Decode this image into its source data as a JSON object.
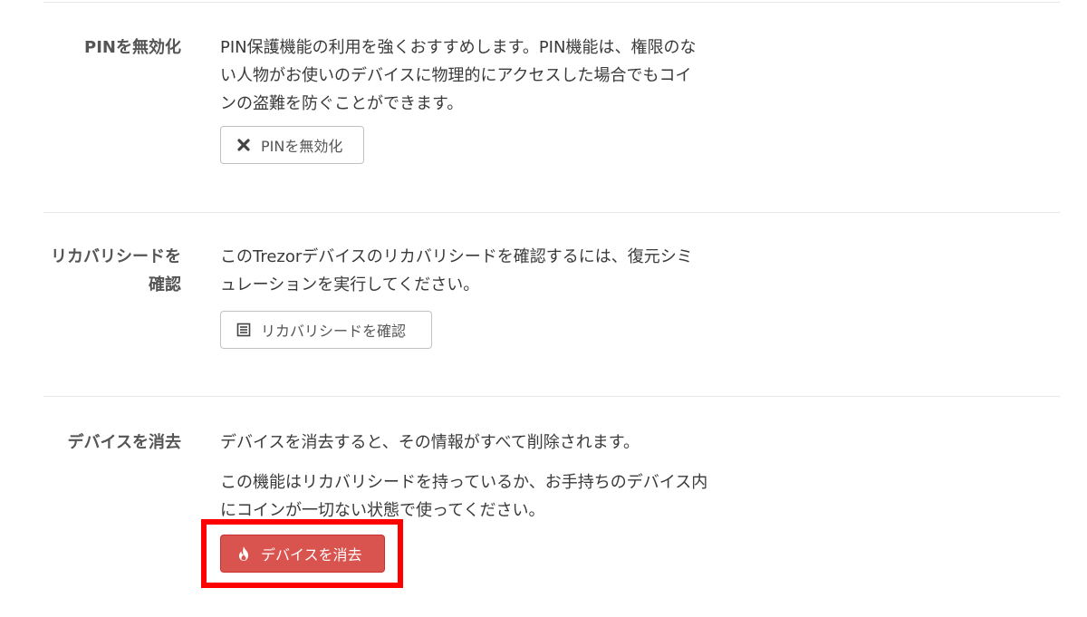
{
  "settings": {
    "disable_pin": {
      "label": "PINを無効化",
      "description": [
        "PIN保護機能の利用を強くおすすめします。PIN機能は、権限のない人物がお使いのデバイスに物理的にアクセスした場合でもコインの盗難を防ぐことができます。"
      ],
      "button_label": "PINを無効化",
      "button_icon": "close-icon"
    },
    "check_seed": {
      "label": "リカバリシードを確認",
      "description": [
        "このTrezorデバイスのリカバリシードを確認するには、復元シミュレーションを実行してください。"
      ],
      "button_label": "リカバリシードを確認",
      "button_icon": "list-icon"
    },
    "wipe_device": {
      "label": "デバイスを消去",
      "description": [
        "デバイスを消去すると、その情報がすべて削除されます。",
        "この機能はリカバリシードを持っているか、お手持ちのデバイス内にコインが一切ない状態で使ってください。"
      ],
      "button_label": "デバイスを消去",
      "button_icon": "fire-icon"
    }
  },
  "colors": {
    "danger": "#d9534f",
    "highlight": "#ff0000",
    "divider": "#e6e6e6"
  }
}
